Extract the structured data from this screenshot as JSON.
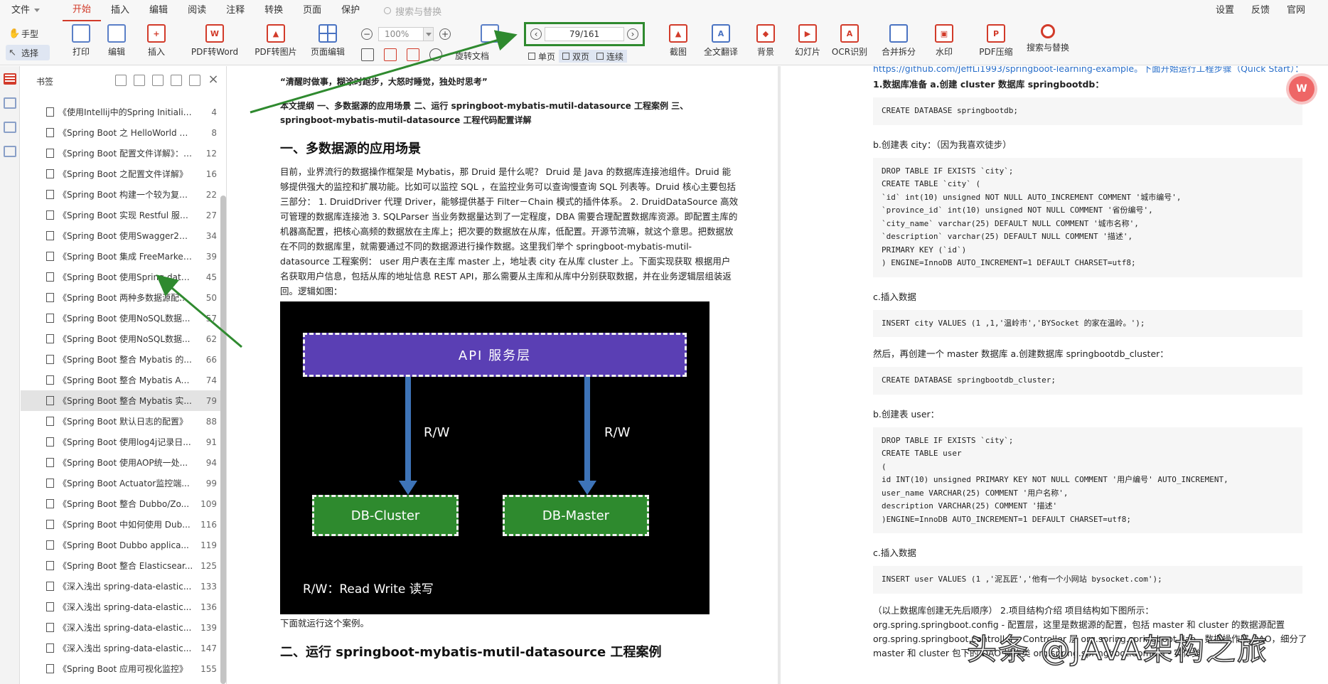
{
  "menubar": {
    "file": "文件",
    "tabs": [
      "开始",
      "插入",
      "编辑",
      "阅读",
      "注释",
      "转换",
      "页面",
      "保护"
    ],
    "search_placeholder": "搜索与替换",
    "right": [
      "设置",
      "反馈",
      "官网"
    ]
  },
  "toolbar": {
    "hand": "手型",
    "select": "选择",
    "buttons": [
      "打印",
      "编辑",
      "插入",
      "PDF转Word",
      "PDF转图片",
      "页面编辑"
    ],
    "zoom": "100%",
    "page_indicator": "79/161",
    "rotate": "旋转文档",
    "view_modes": [
      "单页",
      "双页",
      "连续"
    ],
    "right_buttons": [
      "截图",
      "全文翻译",
      "背景",
      "幻灯片",
      "OCR识别",
      "合并拆分",
      "水印",
      "PDF压缩",
      "搜索与替换"
    ]
  },
  "bookmarks": {
    "title": "书签",
    "items": [
      {
        "text": "《使用Intellij中的Spring Initializr...",
        "page": "4"
      },
      {
        "text": "《Spring Boot 之 HelloWorld 详...",
        "page": "8"
      },
      {
        "text": "《Spring Boot 配置文件详解》：自...",
        "page": "12"
      },
      {
        "text": "《Spring Boot 之配置文件详解》",
        "page": "16"
      },
      {
        "text": "《Spring Boot 构建一个较为复杂...",
        "page": "22"
      },
      {
        "text": "《Spring Boot 实现 Restful 服务...",
        "page": "27"
      },
      {
        "text": "《Spring Boot 使用Swagger2构...",
        "page": "34"
      },
      {
        "text": "《Spring Boot 集成 FreeMarker...",
        "page": "39"
      },
      {
        "text": "《Spring Boot 使用Spring-data...",
        "page": "45"
      },
      {
        "text": "《Spring Boot 两种多数据源配置...",
        "page": "50"
      },
      {
        "text": "《Spring Boot 使用NoSQL数据...",
        "page": "57"
      },
      {
        "text": "《Spring Boot 使用NoSQL数据...",
        "page": "62"
      },
      {
        "text": "《Spring Boot 整合 Mybatis 的...",
        "page": "66"
      },
      {
        "text": "《Spring Boot 整合 Mybatis An...",
        "page": "74"
      },
      {
        "text": "《Spring Boot 整合 Mybatis 实...",
        "page": "79"
      },
      {
        "text": "《Spring Boot 默认日志的配置》",
        "page": "88"
      },
      {
        "text": "《Spring Boot 使用log4j记录日...",
        "page": "91"
      },
      {
        "text": "《Spring Boot 使用AOP统一处...",
        "page": "94"
      },
      {
        "text": "《Spring Boot Actuator监控端...",
        "page": "99"
      },
      {
        "text": "《Spring Boot 整合 Dubbo/Zo...",
        "page": "109"
      },
      {
        "text": "《Spring Boot 中如何使用 Dub...",
        "page": "116"
      },
      {
        "text": "《Spring Boot Dubbo applica...",
        "page": "119"
      },
      {
        "text": "《Spring Boot 整合 Elasticsear...",
        "page": "125"
      },
      {
        "text": "《深入浅出 spring-data-elastic...",
        "page": "133"
      },
      {
        "text": "《深入浅出 spring-data-elastic...",
        "page": "136"
      },
      {
        "text": "《深入浅出 spring-data-elastic...",
        "page": "139"
      },
      {
        "text": "《深入浅出 spring-data-elastic...",
        "page": "147"
      },
      {
        "text": "《Spring Boot 应用可视化监控》",
        "page": "155"
      }
    ]
  },
  "page_left": {
    "quote": "“清醒时做事，糊涂时跑步，大怒时睡觉，独处时思考”",
    "summary": "本文提纲 一、多数据源的应用场景 二、运行 springboot-mybatis-mutil-datasource 工程案例 三、springboot-mybatis-mutil-datasource 工程代码配置详解",
    "heading1": "一、多数据源的应用场景",
    "body": "目前，业界流行的数据操作框架是 Mybatis，那 Druid 是什么呢？ Druid 是 Java 的数据库连接池组件。Druid 能够提供强大的监控和扩展功能。比如可以监控 SQL ，在监控业务可以查询慢查询 SQL 列表等。Druid 核心主要包括三部分： 1. DruidDriver 代理 Driver，能够提供基于 Filter－Chain 模式的插件体系。 2. DruidDataSource 高效可管理的数据库连接池 3. SQLParser 当业务数据量达到了一定程度，DBA 需要合理配置数据库资源。即配置主库的机器高配置，把核心高频的数据放在主库上；把次要的数据放在从库，低配置。开源节流嘛，就这个意思。把数据放在不同的数据库里，就需要通过不同的数据源进行操作数据。这里我们举个 springboot-mybatis-mutil-datasource 工程案例： user 用户表在主库 master 上，地址表 city 在从库 cluster 上。下面实现获取 根据用户名获取用户信息，包括从库的地址信息 REST API，那么需要从主库和从库中分别获取数据，并在业务逻辑层组装返回。逻辑如图：",
    "diagram": {
      "api": "API 服务层",
      "rw": "R/W",
      "cluster": "DB-Cluster",
      "master": "DB-Master",
      "note": "R/W：Read Write 读写"
    },
    "after_diagram": "下面就运行这个案例。",
    "heading2": "二、运行 springboot-mybatis-mutil-datasource 工程案例"
  },
  "page_right": {
    "link_line": "https://github.com/JeffLi1993/springboot-learning-example。下面开始运行工程步骤（Quick Start）：",
    "step1": "1.数据库准备 a.创建 cluster 数据库 springbootdb：",
    "code1": "CREATE DATABASE springbootdb;",
    "step_b1": "b.创建表 city：（因为我喜欢徒步）",
    "code2": "DROP TABLE IF EXISTS `city`;\nCREATE TABLE `city` (\n`id` int(10) unsigned NOT NULL AUTO_INCREMENT COMMENT '城市编号',\n`province_id` int(10) unsigned NOT NULL COMMENT '省份编号',\n`city_name` varchar(25) DEFAULT NULL COMMENT '城市名称',\n`description` varchar(25) DEFAULT NULL COMMENT '描述',\nPRIMARY KEY (`id`)\n) ENGINE=InnoDB AUTO_INCREMENT=1 DEFAULT CHARSET=utf8;",
    "step_c1": "c.插入数据",
    "code3": "INSERT city VALUES (1 ,1,'温岭市','BYSocket 的家在温岭。');",
    "step2": "然后，再创建一个 master 数据库 a.创建数据库 springbootdb_cluster：",
    "code4": "CREATE DATABASE springbootdb_cluster;",
    "step_b2": "b.创建表 user：",
    "code5": "DROP TABLE IF EXISTS `city`;\nCREATE TABLE user\n(\nid INT(10) unsigned PRIMARY KEY NOT NULL COMMENT '用户编号' AUTO_INCREMENT,\nuser_name VARCHAR(25) COMMENT '用户名称',\ndescription VARCHAR(25) COMMENT '描述'\n)ENGINE=InnoDB AUTO_INCREMENT=1 DEFAULT CHARSET=utf8;",
    "step_c2": "c.插入数据",
    "code6": "INSERT user VALUES (1 ,'泥瓦匠','他有一个小网站 bysocket.com');",
    "foot1": "（以上数据库创建无先后顺序） 2.项目结构介绍 项目结构如下图所示：",
    "foot2": "org.spring.springboot.config - 配置层，这里是数据源的配置，包括 master 和 cluster 的数据源配置",
    "foot3": "org.spring.springboot.controller - Controller 层 org.spring.springboot.dao - 数据操作层 DAO，细分了",
    "foot4": "master 和 cluster 包下的 DAO 操作类 org.spring.springboot.domain - 实体类"
  },
  "watermark": "头条 @JAVA架构之旅",
  "colors": {
    "accent_red": "#d23b2a",
    "highlight_green": "#2f8a2f",
    "api_purple": "#5a3fb4",
    "db_green": "#2e8a2e",
    "link_blue": "#2a6fc9"
  }
}
